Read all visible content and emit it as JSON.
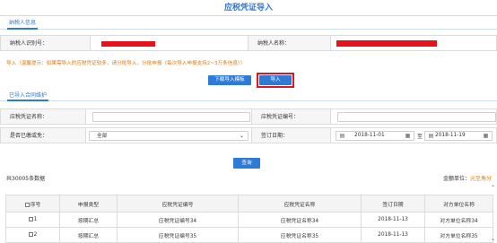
{
  "header": {
    "title": "应税凭证导入"
  },
  "tabs": {
    "taxpayer_info": "纳税人信息",
    "imported_contracts": "已导入合同维护"
  },
  "taxpayer": {
    "id_label": "纳税人识别号：",
    "name_label": "纳税人名称："
  },
  "hint": "导入（温馨提示：如果需导入的应税凭证较多，请分批导入，分批申报（每次导入申报支持2~3万条信息））",
  "buttons": {
    "download_template": "下载导入模板",
    "import": "导入",
    "query": "查询"
  },
  "filters": {
    "voucher_name_label": "应税凭证名称：",
    "voucher_no_label": "应税凭证编号：",
    "reconciled_label": "是否已缴或免：",
    "reconciled_value": "全部",
    "sign_date_label": "签订日期：",
    "date_from": "2018-11-01",
    "date_sep": "至",
    "date_to": "2018-11-19"
  },
  "summary": {
    "count_text": "共30005条数据",
    "unit_label": "金额单位：",
    "unit_value": "元至角分"
  },
  "table": {
    "headers": [
      "序号",
      "申报类型",
      "应税凭证编号",
      "应税凭证名称",
      "签订日期",
      "对方单位名称"
    ],
    "rows": [
      [
        "1",
        "按期汇总",
        "应税凭证编号34",
        "应税凭证名称34",
        "2018-11-13",
        "对方单位名称34"
      ],
      [
        "2",
        "按期汇总",
        "应税凭证编号35",
        "应税凭证名称35",
        "2018-11-13",
        "对方单位名称35"
      ]
    ]
  },
  "colors": {
    "accent": "#2d7bd6",
    "redact": "#e8121b",
    "highlight": "#e3151c",
    "hint": "#e07b14"
  }
}
